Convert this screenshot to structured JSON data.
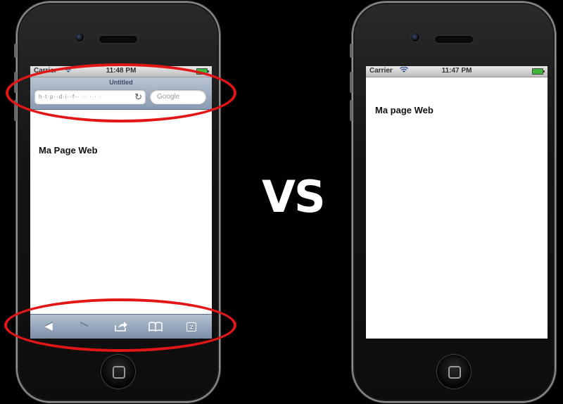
{
  "left_phone": {
    "status": {
      "carrier": "Carrier",
      "time": "11:48 PM",
      "wifi_icon": "wifi-icon",
      "battery_icon": "battery-icon"
    },
    "safari": {
      "page_title": "Untitled",
      "url_text": "h·t·p··d·i··f·· ·· ·  · ·",
      "reload_icon": "reload-icon",
      "search_placeholder": "Google"
    },
    "page_heading": "Ma Page Web",
    "toolbar": {
      "back_icon": "back-arrow-icon",
      "forward_icon": "forward-arrow-icon",
      "share_icon": "share-icon",
      "bookmarks_icon": "bookmarks-icon",
      "pages_icon": "pages-icon",
      "pages_count": "2"
    }
  },
  "vs_label": "VS",
  "right_phone": {
    "status": {
      "carrier": "Carrier",
      "time": "11:47 PM",
      "wifi_icon": "wifi-icon",
      "battery_icon": "battery-icon"
    },
    "page_heading": "Ma page Web"
  },
  "highlight_color": "#e21616"
}
